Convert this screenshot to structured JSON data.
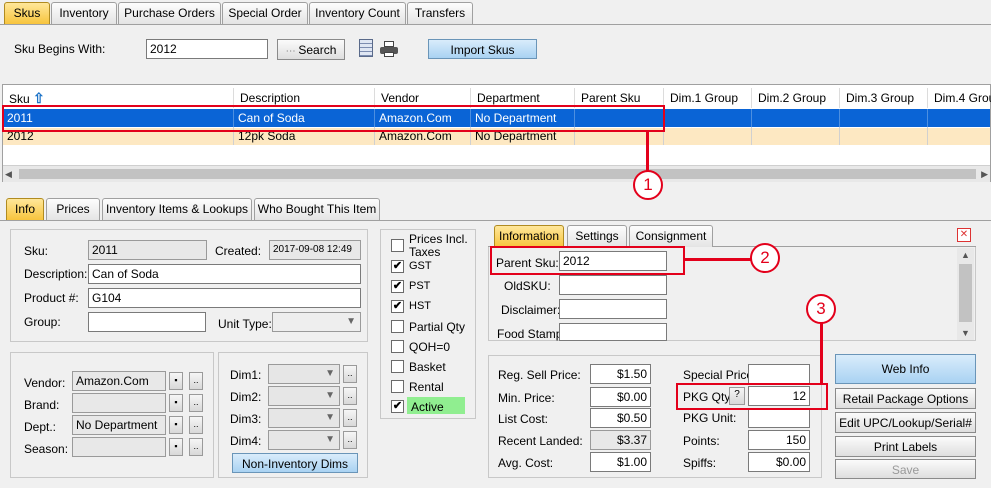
{
  "top_tabs": [
    "Skus",
    "Inventory",
    "Purchase Orders",
    "Special Order",
    "Inventory Count",
    "Transfers"
  ],
  "search": {
    "label": "Sku Begins With:",
    "value": "2012",
    "search_btn": "Search",
    "import_btn": "Import Skus"
  },
  "grid": {
    "headers": [
      "Sku",
      "Description",
      "Vendor",
      "Department",
      "Parent Sku",
      "Dim.1 Group",
      "Dim.2 Group",
      "Dim.3 Group",
      "Dim.4 Group"
    ],
    "rows": [
      [
        "2011",
        "Can of Soda",
        "Amazon.Com",
        "No Department"
      ],
      [
        "2012",
        "12pk Soda",
        "Amazon.Com",
        "No Department"
      ]
    ]
  },
  "detail_tabs": [
    "Info",
    "Prices",
    "Inventory Items & Lookups",
    "Who Bought This Item"
  ],
  "info": {
    "sku_label": "Sku:",
    "sku": "2011",
    "created_label": "Created:",
    "created": "2017-09-08 12:49",
    "desc_label": "Description:",
    "desc": "Can of Soda",
    "prod_label": "Product #:",
    "prod": "G104",
    "group_label": "Group:",
    "unit_label": "Unit Type:",
    "vendor_label": "Vendor:",
    "vendor": "Amazon.Com",
    "brand_label": "Brand:",
    "dept_label": "Dept.:",
    "dept": "No Department",
    "season_label": "Season:",
    "dim_labels": [
      "Dim1:",
      "Dim2:",
      "Dim3:",
      "Dim4:"
    ],
    "non_inv_btn": "Non-Inventory Dims"
  },
  "checks": {
    "prices_incl": "Prices Incl. Taxes",
    "items": [
      {
        "label": "GST",
        "checked": "✔"
      },
      {
        "label": "PST",
        "checked": "✔"
      },
      {
        "label": "HST",
        "checked": "✔"
      },
      {
        "label": "Partial Qty",
        "checked": ""
      },
      {
        "label": "QOH=0",
        "checked": ""
      },
      {
        "label": "Basket",
        "checked": ""
      },
      {
        "label": "Rental",
        "checked": ""
      },
      {
        "label": "Active",
        "checked": "✔"
      }
    ]
  },
  "right_tabs": [
    "Information",
    "Settings",
    "Consignment"
  ],
  "rinfo": {
    "parent_label": "Parent Sku:",
    "parent": "2012",
    "oldsku_label": "OldSKU:",
    "disclaimer_label": "Disclaimer:",
    "foodstamp_label": "Food Stamp:"
  },
  "prices": {
    "left": [
      {
        "label": "Reg. Sell Price:",
        "value": "$1.50"
      },
      {
        "label": "Min. Price:",
        "value": "$0.00"
      },
      {
        "label": "List Cost:",
        "value": "$0.50"
      },
      {
        "label": "Recent Landed:",
        "value": "$3.37"
      },
      {
        "label": "Avg. Cost:",
        "value": "$1.00"
      }
    ],
    "special_label": "Special Price:",
    "pkg_label": "PKG Qty:",
    "pkg_q": "?",
    "pkg_value": "12",
    "pkgunit_label": "PKG Unit:",
    "points_label": "Points:",
    "points": "150",
    "spiffs_label": "Spiffs:",
    "spiffs": "$0.00"
  },
  "side_buttons": [
    "Web Info",
    "Retail Package Options",
    "Edit UPC/Lookup/Serial#",
    "Print Labels",
    "Save"
  ],
  "callouts": [
    "1",
    "2",
    "3"
  ],
  "colors": {
    "highlight": "#e3001b",
    "selected_row": "#0a64d6",
    "alt_row": "#fde8c2",
    "active_tab": "#f7c43d",
    "active_check": "#90ee90"
  }
}
